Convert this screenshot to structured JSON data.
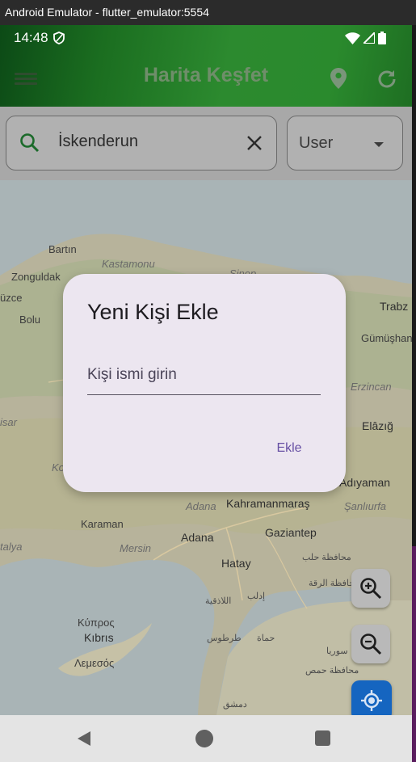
{
  "window": {
    "title": "Android Emulator - flutter_emulator:5554"
  },
  "status_bar": {
    "time": "14:48"
  },
  "app_bar": {
    "title": "Harita Keşfet"
  },
  "search": {
    "value": "İskenderun",
    "user_select": "User"
  },
  "map_labels": {
    "bartin": "Bartın",
    "kastamonu": "Kastamonu",
    "zonguldak": "Zonguldak",
    "duzce": "üzce",
    "bolu": "Bolu",
    "trabzon": "Trabz",
    "gumushane": "Gümüşhan",
    "erzincan": "Erzincan",
    "sinop": "Sinop",
    "elazig": "Elâzığ",
    "isar": "isar",
    "ko": "Ko",
    "adiyaman": "Adıyaman",
    "adana_it": "Adana",
    "kahramanmaras": "Kahramanmaraş",
    "sanliurfa": "Şanlıurfa",
    "karaman": "Karaman",
    "gaziantep": "Gaziantep",
    "talya": "talya",
    "mersin": "Mersin",
    "adana": "Adana",
    "hatay": "Hatay",
    "muhafaza": "محافظة حلب",
    "rakka": "محافظة الرقة",
    "lazkiye": "اللاذقية",
    "idlib": "إدلب",
    "tartus": "طرطوس",
    "hama": "حماة",
    "kypros": "Κύπρος",
    "kibris": "Kıbrıs",
    "lemesos": "Λεμεσός",
    "suriye": "سوريا",
    "humus": "محافظة حمص",
    "dimashq": "دمشق"
  },
  "dialog": {
    "title": "Yeni Kişi Ekle",
    "placeholder": "Kişi ismi girin",
    "add_label": "Ekle"
  },
  "icons": {
    "menu": "menu-icon",
    "location": "location-pin-icon",
    "refresh": "refresh-icon",
    "search": "search-icon",
    "clear": "close-icon",
    "zoom_in": "zoom-in-icon",
    "zoom_out": "zoom-out-icon",
    "my_location": "my-location-icon"
  },
  "colors": {
    "app_bar": "#2a8a2d",
    "dialog_bg": "#ece6f0",
    "accent": "#6750a4",
    "fab_blue": "#1565c0"
  }
}
